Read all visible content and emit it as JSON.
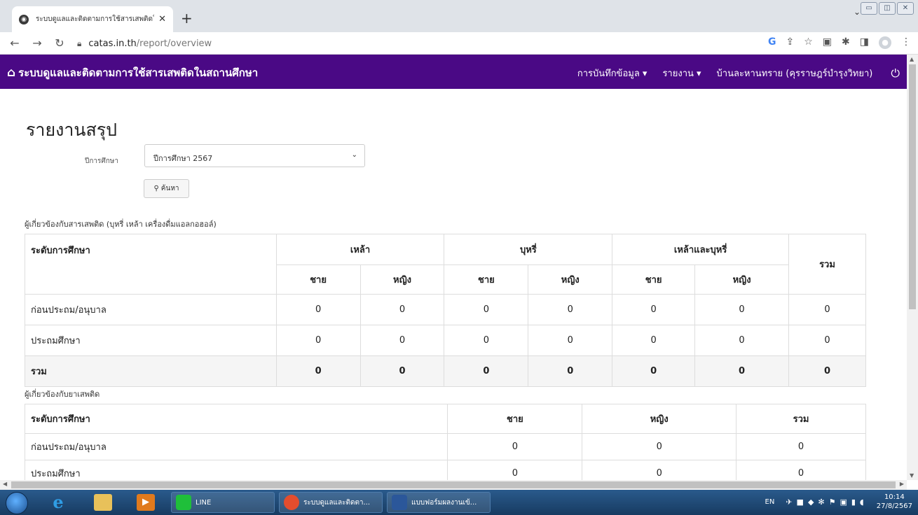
{
  "browser": {
    "tab_title": "ระบบดูแลและติดตามการใช้สารเสพติดใ",
    "new_tab_symbol": "+",
    "url_host": "catas.in.th",
    "url_path": "/report/overview"
  },
  "navbar": {
    "brand": "ระบบดูแลและติดตามการใช้สารเสพติดในสถานศึกษา",
    "menu_record": "การบันทึกข้อมูล ▾",
    "menu_report": "รายงาน ▾",
    "user": "บ้านละหานทราย (คุรราษฎร์บำรุงวิทยา)"
  },
  "page": {
    "title": "รายงานสรุป",
    "filter_label": "ปีการศึกษา",
    "filter_value": "ปีการศึกษา 2567",
    "search_button": "ค้นหา"
  },
  "table1": {
    "title": "ผู้เกี่ยวข้องกับสารเสพติด (บุหรี่ เหล้า เครื่องดื่มแอลกอฮอล์)",
    "col_level": "ระดับการศึกษา",
    "groups": [
      "เหล้า",
      "บุหรี่",
      "เหล้าและบุหรี่"
    ],
    "col_total": "รวม",
    "male": "ชาย",
    "female": "หญิง",
    "rows": [
      {
        "label": "ก่อนประถม/อนุบาล",
        "values": [
          "0",
          "0",
          "0",
          "0",
          "0",
          "0",
          "0"
        ]
      },
      {
        "label": "ประถมศึกษา",
        "values": [
          "0",
          "0",
          "0",
          "0",
          "0",
          "0",
          "0"
        ]
      },
      {
        "label": "รวม",
        "values": [
          "0",
          "0",
          "0",
          "0",
          "0",
          "0",
          "0"
        ]
      }
    ]
  },
  "table2": {
    "title": "ผู้เกี่ยวข้องกับยาเสพติด",
    "headers": [
      "ระดับการศึกษา",
      "ชาย",
      "หญิง",
      "รวม"
    ],
    "rows": [
      {
        "label": "ก่อนประถม/อนุบาล",
        "values": [
          "0",
          "0",
          "0"
        ]
      },
      {
        "label": "ประถมศึกษา",
        "values": [
          "0",
          "0",
          "0"
        ]
      }
    ]
  },
  "taskbar": {
    "line_label": "LINE",
    "chrome_label": "ระบบดูแลและติดตา...",
    "word_label": "แบบฟอร์มผลงานเข้...",
    "lang": "EN",
    "time": "10:14",
    "date": "27/8/2567"
  }
}
